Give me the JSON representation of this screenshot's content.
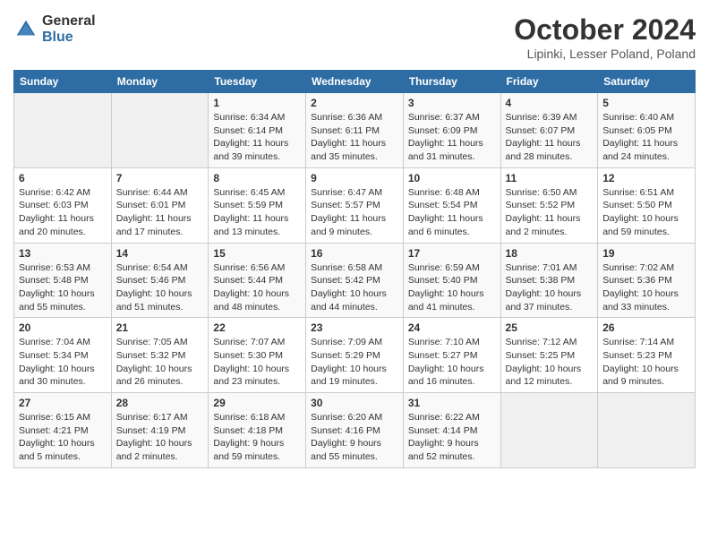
{
  "header": {
    "logo_general": "General",
    "logo_blue": "Blue",
    "title": "October 2024",
    "location": "Lipinki, Lesser Poland, Poland"
  },
  "days_of_week": [
    "Sunday",
    "Monday",
    "Tuesday",
    "Wednesday",
    "Thursday",
    "Friday",
    "Saturday"
  ],
  "weeks": [
    [
      {
        "day": "",
        "info": ""
      },
      {
        "day": "",
        "info": ""
      },
      {
        "day": "1",
        "info": "Sunrise: 6:34 AM\nSunset: 6:14 PM\nDaylight: 11 hours and 39 minutes."
      },
      {
        "day": "2",
        "info": "Sunrise: 6:36 AM\nSunset: 6:11 PM\nDaylight: 11 hours and 35 minutes."
      },
      {
        "day": "3",
        "info": "Sunrise: 6:37 AM\nSunset: 6:09 PM\nDaylight: 11 hours and 31 minutes."
      },
      {
        "day": "4",
        "info": "Sunrise: 6:39 AM\nSunset: 6:07 PM\nDaylight: 11 hours and 28 minutes."
      },
      {
        "day": "5",
        "info": "Sunrise: 6:40 AM\nSunset: 6:05 PM\nDaylight: 11 hours and 24 minutes."
      }
    ],
    [
      {
        "day": "6",
        "info": "Sunrise: 6:42 AM\nSunset: 6:03 PM\nDaylight: 11 hours and 20 minutes."
      },
      {
        "day": "7",
        "info": "Sunrise: 6:44 AM\nSunset: 6:01 PM\nDaylight: 11 hours and 17 minutes."
      },
      {
        "day": "8",
        "info": "Sunrise: 6:45 AM\nSunset: 5:59 PM\nDaylight: 11 hours and 13 minutes."
      },
      {
        "day": "9",
        "info": "Sunrise: 6:47 AM\nSunset: 5:57 PM\nDaylight: 11 hours and 9 minutes."
      },
      {
        "day": "10",
        "info": "Sunrise: 6:48 AM\nSunset: 5:54 PM\nDaylight: 11 hours and 6 minutes."
      },
      {
        "day": "11",
        "info": "Sunrise: 6:50 AM\nSunset: 5:52 PM\nDaylight: 11 hours and 2 minutes."
      },
      {
        "day": "12",
        "info": "Sunrise: 6:51 AM\nSunset: 5:50 PM\nDaylight: 10 hours and 59 minutes."
      }
    ],
    [
      {
        "day": "13",
        "info": "Sunrise: 6:53 AM\nSunset: 5:48 PM\nDaylight: 10 hours and 55 minutes."
      },
      {
        "day": "14",
        "info": "Sunrise: 6:54 AM\nSunset: 5:46 PM\nDaylight: 10 hours and 51 minutes."
      },
      {
        "day": "15",
        "info": "Sunrise: 6:56 AM\nSunset: 5:44 PM\nDaylight: 10 hours and 48 minutes."
      },
      {
        "day": "16",
        "info": "Sunrise: 6:58 AM\nSunset: 5:42 PM\nDaylight: 10 hours and 44 minutes."
      },
      {
        "day": "17",
        "info": "Sunrise: 6:59 AM\nSunset: 5:40 PM\nDaylight: 10 hours and 41 minutes."
      },
      {
        "day": "18",
        "info": "Sunrise: 7:01 AM\nSunset: 5:38 PM\nDaylight: 10 hours and 37 minutes."
      },
      {
        "day": "19",
        "info": "Sunrise: 7:02 AM\nSunset: 5:36 PM\nDaylight: 10 hours and 33 minutes."
      }
    ],
    [
      {
        "day": "20",
        "info": "Sunrise: 7:04 AM\nSunset: 5:34 PM\nDaylight: 10 hours and 30 minutes."
      },
      {
        "day": "21",
        "info": "Sunrise: 7:05 AM\nSunset: 5:32 PM\nDaylight: 10 hours and 26 minutes."
      },
      {
        "day": "22",
        "info": "Sunrise: 7:07 AM\nSunset: 5:30 PM\nDaylight: 10 hours and 23 minutes."
      },
      {
        "day": "23",
        "info": "Sunrise: 7:09 AM\nSunset: 5:29 PM\nDaylight: 10 hours and 19 minutes."
      },
      {
        "day": "24",
        "info": "Sunrise: 7:10 AM\nSunset: 5:27 PM\nDaylight: 10 hours and 16 minutes."
      },
      {
        "day": "25",
        "info": "Sunrise: 7:12 AM\nSunset: 5:25 PM\nDaylight: 10 hours and 12 minutes."
      },
      {
        "day": "26",
        "info": "Sunrise: 7:14 AM\nSunset: 5:23 PM\nDaylight: 10 hours and 9 minutes."
      }
    ],
    [
      {
        "day": "27",
        "info": "Sunrise: 6:15 AM\nSunset: 4:21 PM\nDaylight: 10 hours and 5 minutes."
      },
      {
        "day": "28",
        "info": "Sunrise: 6:17 AM\nSunset: 4:19 PM\nDaylight: 10 hours and 2 minutes."
      },
      {
        "day": "29",
        "info": "Sunrise: 6:18 AM\nSunset: 4:18 PM\nDaylight: 9 hours and 59 minutes."
      },
      {
        "day": "30",
        "info": "Sunrise: 6:20 AM\nSunset: 4:16 PM\nDaylight: 9 hours and 55 minutes."
      },
      {
        "day": "31",
        "info": "Sunrise: 6:22 AM\nSunset: 4:14 PM\nDaylight: 9 hours and 52 minutes."
      },
      {
        "day": "",
        "info": ""
      },
      {
        "day": "",
        "info": ""
      }
    ]
  ]
}
